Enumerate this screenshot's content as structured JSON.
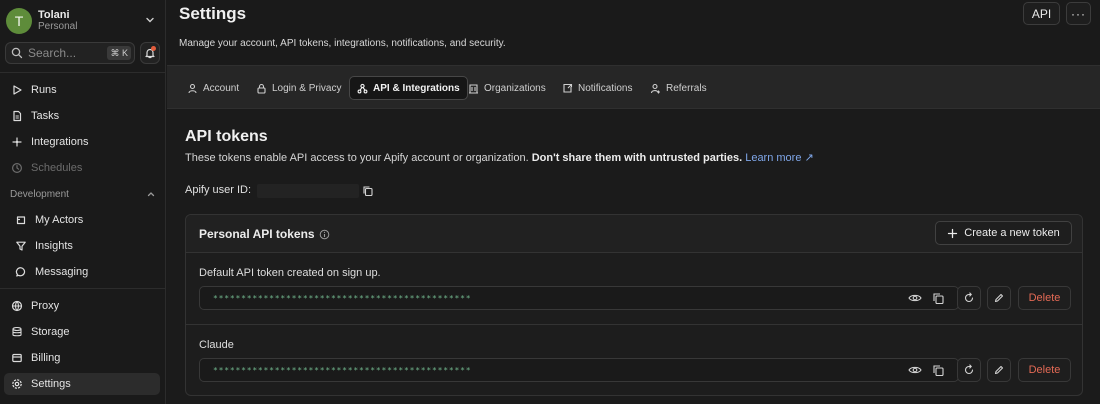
{
  "profile": {
    "initial": "T",
    "name": "Tolani",
    "sub": "Personal",
    "avatar_color": "#5e8c3a"
  },
  "search": {
    "placeholder": "Search...",
    "shortcut": "⌘ K"
  },
  "sidebar": {
    "main_items": [
      {
        "label": "Runs",
        "icon": "play-icon"
      },
      {
        "label": "Tasks",
        "icon": "document-icon"
      },
      {
        "label": "Integrations",
        "icon": "integrations-icon"
      },
      {
        "label": "Schedules",
        "icon": "clock-icon",
        "disabled": true
      }
    ],
    "dev_section": {
      "label": "Development",
      "items": [
        {
          "label": "My Actors",
          "icon": "actor-icon"
        },
        {
          "label": "Insights",
          "icon": "funnel-icon"
        },
        {
          "label": "Messaging",
          "icon": "chat-icon"
        }
      ]
    },
    "bottom_items": [
      {
        "label": "Proxy",
        "icon": "globe-icon"
      },
      {
        "label": "Storage",
        "icon": "database-icon"
      },
      {
        "label": "Billing",
        "icon": "billing-icon"
      },
      {
        "label": "Settings",
        "icon": "gear-icon",
        "active": true
      }
    ]
  },
  "header": {
    "title": "Settings",
    "subtitle": "Manage your account, API tokens, integrations, notifications, and security.",
    "api_label": "API",
    "more_label": "···"
  },
  "tabs": [
    {
      "label": "Account",
      "icon": "person-icon"
    },
    {
      "label": "Login & Privacy",
      "icon": "lock-icon"
    },
    {
      "label": "API & Integrations",
      "icon": "api-icon",
      "active": true
    },
    {
      "label": "Organizations",
      "icon": "building-icon"
    },
    {
      "label": "Notifications",
      "icon": "notification-icon"
    },
    {
      "label": "Referrals",
      "icon": "referral-icon"
    }
  ],
  "api_tokens": {
    "title": "API tokens",
    "desc_plain": "These tokens enable API access to your Apify account or organization. ",
    "desc_bold": "Don't share them with untrusted parties.",
    "learn_more": "Learn more ↗",
    "user_id_label": "Apify user ID:",
    "card_title": "Personal API tokens",
    "create_label": "Create a new token",
    "tokens": [
      {
        "description": "Default API token created on sign up.",
        "value": "**********************************************",
        "delete_label": "Delete"
      },
      {
        "description": "Claude",
        "value": "**********************************************",
        "delete_label": "Delete"
      }
    ]
  },
  "colors": {
    "accent_link": "#7fa6e8",
    "delete": "#e46a55",
    "token_text": "#6fb38a"
  }
}
